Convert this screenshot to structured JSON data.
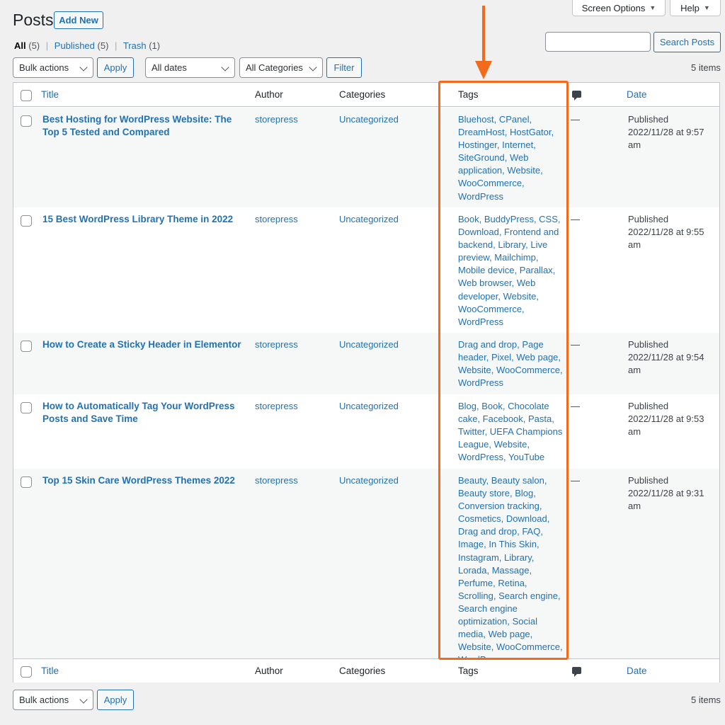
{
  "header": {
    "screen_options": "Screen Options",
    "help": "Help",
    "title": "Posts",
    "add_new": "Add New"
  },
  "views": {
    "all": "All",
    "all_count": "(5)",
    "published": "Published",
    "published_count": "(5)",
    "trash": "Trash",
    "trash_count": "(1)"
  },
  "search": {
    "button": "Search Posts",
    "value": ""
  },
  "toolbar": {
    "bulk_actions": "Bulk actions",
    "apply": "Apply",
    "dates": "All dates",
    "categories": "All Categories",
    "filter": "Filter",
    "items": "5 items"
  },
  "columns": {
    "title": "Title",
    "author": "Author",
    "categories": "Categories",
    "tags": "Tags",
    "date": "Date"
  },
  "posts": [
    {
      "title": "Best Hosting for WordPress Website: The Top 5 Tested and Compared",
      "author": "storepress",
      "category": "Uncategorized",
      "tags": "Bluehost, CPanel, DreamHost, HostGator, Hostinger, Internet, SiteGround, Web application, Website, WooCommerce, WordPress",
      "comments": "—",
      "status": "Published",
      "date": "2022/11/28 at 9:57 am"
    },
    {
      "title": "15 Best WordPress Library Theme in 2022",
      "author": "storepress",
      "category": "Uncategorized",
      "tags": "Book, BuddyPress, CSS, Download, Frontend and backend, Library, Live preview, Mailchimp, Mobile device, Parallax, Web browser, Web developer, Website, WooCommerce, WordPress",
      "comments": "—",
      "status": "Published",
      "date": "2022/11/28 at 9:55 am"
    },
    {
      "title": "How to Create a Sticky Header in Elementor",
      "author": "storepress",
      "category": "Uncategorized",
      "tags": "Drag and drop, Page header, Pixel, Web page, Website, WooCommerce, WordPress",
      "comments": "—",
      "status": "Published",
      "date": "2022/11/28 at 9:54 am"
    },
    {
      "title": "How to Automatically Tag Your WordPress Posts and Save Time",
      "author": "storepress",
      "category": "Uncategorized",
      "tags": "Blog, Book, Chocolate cake, Facebook, Pasta, Twitter, UEFA Champions League, Website, WordPress, YouTube",
      "comments": "—",
      "status": "Published",
      "date": "2022/11/28 at 9:53 am"
    },
    {
      "title": "Top 15 Skin Care WordPress Themes 2022",
      "author": "storepress",
      "category": "Uncategorized",
      "tags": "Beauty, Beauty salon, Beauty store, Blog, Conversion tracking, Cosmetics, Download, Drag and drop, FAQ, Image, In This Skin, Instagram, Library, Lorada, Massage, Perfume, Retina, Scrolling, Search engine, Search engine optimization, Social media, Web page, Website, WooCommerce, WordPress",
      "comments": "—",
      "status": "Published",
      "date": "2022/11/28 at 9:31 am"
    }
  ],
  "colors": {
    "link": "#2271b1",
    "highlight": "#f26a1b",
    "row_alt": "#f6f7f7"
  }
}
